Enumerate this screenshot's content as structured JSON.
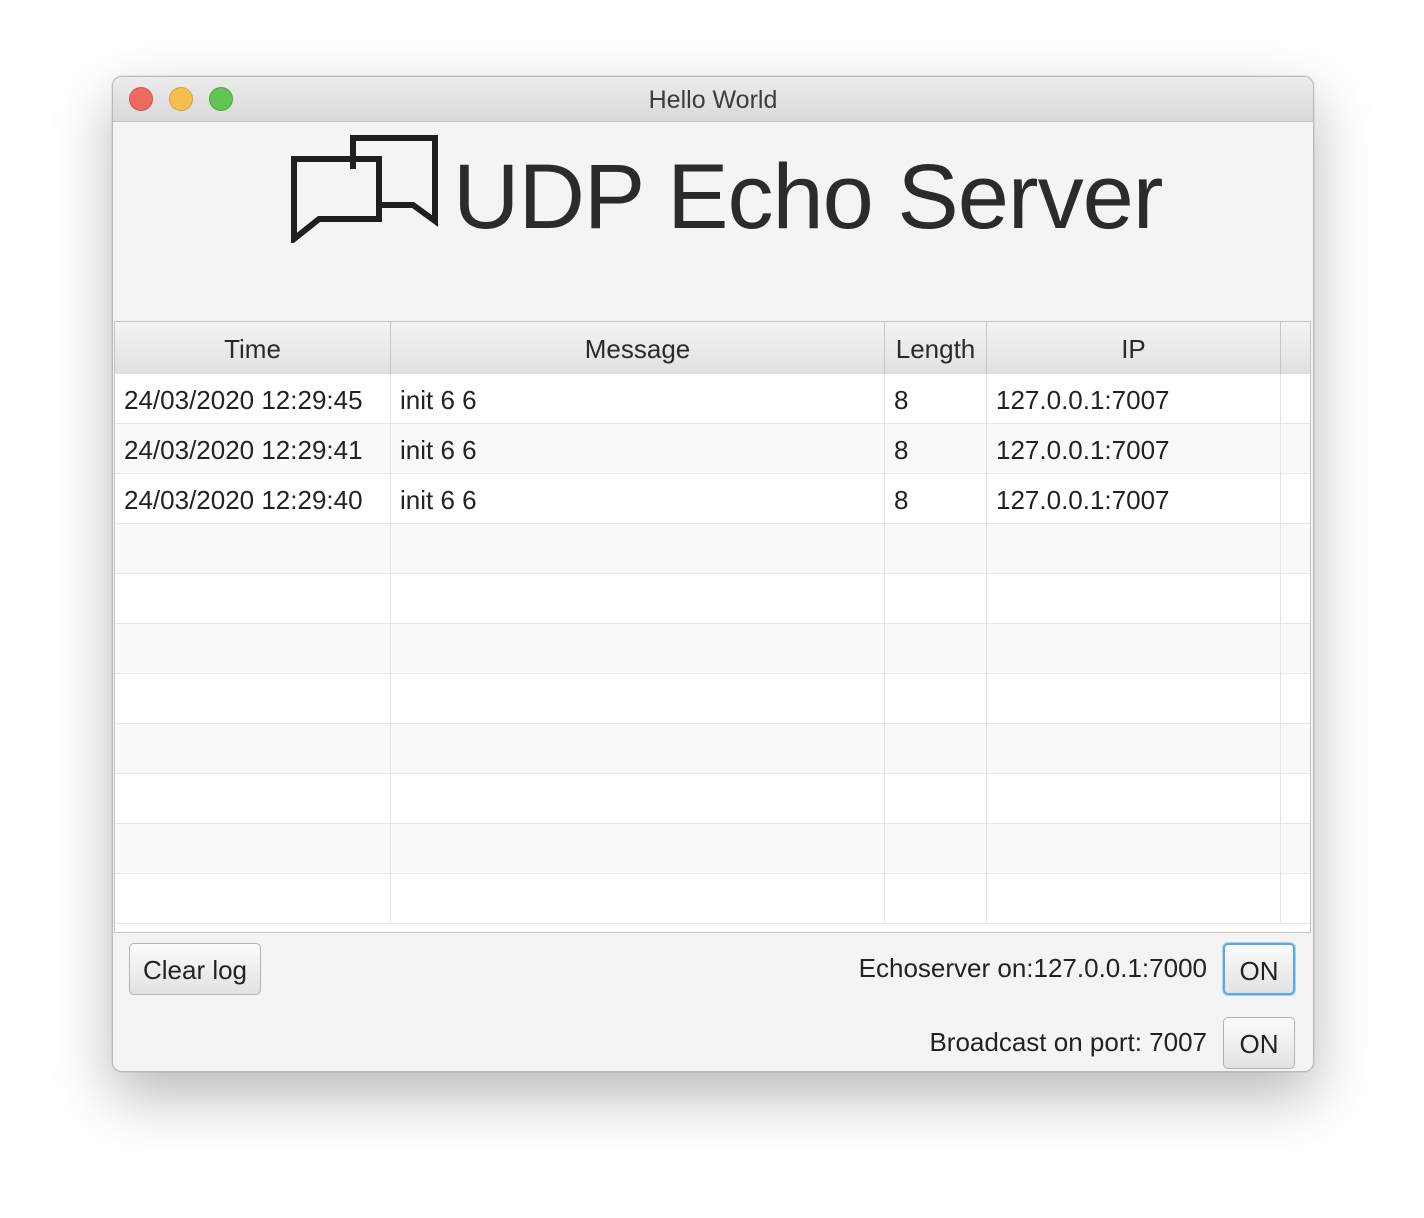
{
  "window": {
    "title": "Hello World"
  },
  "header": {
    "title": "UDP Echo Server",
    "icon": "chat-bubbles-icon"
  },
  "table": {
    "columns": [
      "Time",
      "Message",
      "Length",
      "IP"
    ],
    "rows": [
      {
        "time": "24/03/2020 12:29:45",
        "message": "init 6 6",
        "length": "8",
        "ip": "127.0.0.1:7007"
      },
      {
        "time": "24/03/2020 12:29:41",
        "message": "init 6 6",
        "length": "8",
        "ip": "127.0.0.1:7007"
      },
      {
        "time": "24/03/2020 12:29:40",
        "message": "init 6 6",
        "length": "8",
        "ip": "127.0.0.1:7007"
      }
    ]
  },
  "footer": {
    "clear_label": "Clear log",
    "echo_status": "Echoserver  on:127.0.0.1:7000",
    "echo_button": "ON",
    "broadcast_status": "Broadcast on port: 7007",
    "broadcast_button": "ON"
  },
  "colors": {
    "close": "#ed6a5e",
    "minimize": "#f5bf4f",
    "zoom": "#61c554",
    "focus_ring": "#5aa9e6"
  }
}
